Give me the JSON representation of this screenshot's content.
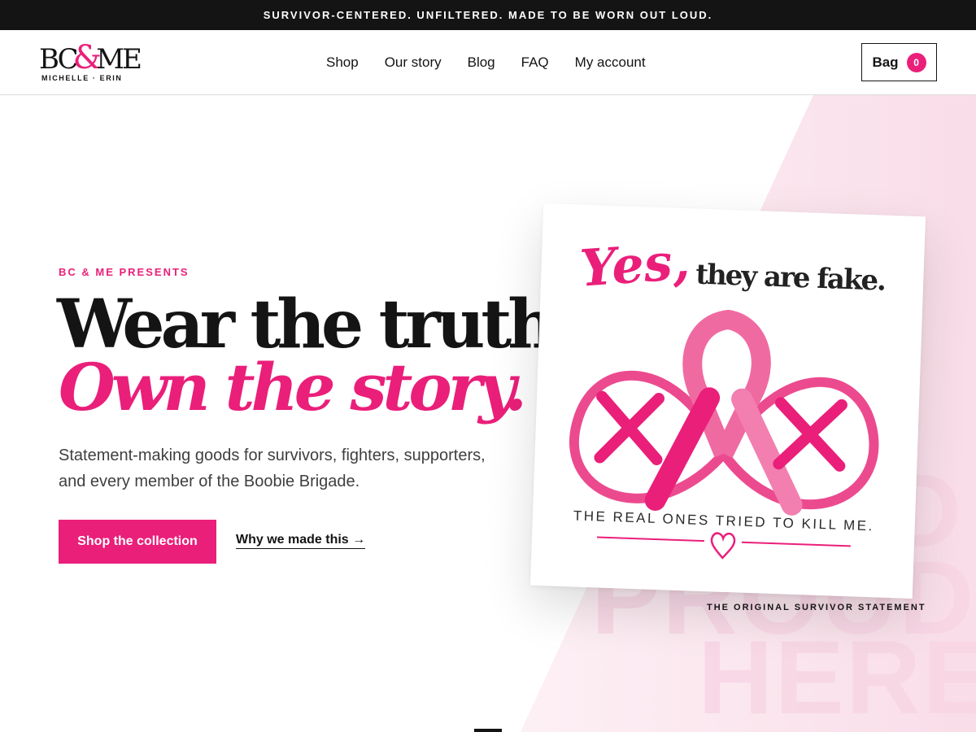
{
  "announcement": "SURVIVOR-CENTERED. UNFILTERED. MADE TO BE WORN OUT LOUD.",
  "logo": {
    "main_left": "BC",
    "amp": "&",
    "main_right": "ME",
    "sub": "MICHELLE · ERIN"
  },
  "nav": [
    "Shop",
    "Our story",
    "Blog",
    "FAQ",
    "My account"
  ],
  "bag": {
    "label": "Bag",
    "count": "0"
  },
  "hero": {
    "eyebrow": "BC & ME PRESENTS",
    "headline": "Wear the truth.",
    "headline_accent": "Own the story.",
    "lead": "Statement-making goods for survivors, fighters, supporters, and every member of the Boobie Brigade.",
    "primary_cta": "Shop the collection",
    "secondary_cta": "Why we made this →"
  },
  "ghost_text": [
    "D",
    "PROUD",
    "HERE"
  ],
  "product_card": {
    "script_word": "Yes,",
    "tagline": "they are fake.",
    "subline": "THE REAL ONES TRIED TO KILL ME.",
    "caption": "THE ORIGINAL SURVIVOR STATEMENT"
  },
  "colors": {
    "accent": "#ea1f7a",
    "ink": "#141414",
    "announce_bg": "#141414",
    "ghost": "#f8d5e4"
  },
  "icons": [
    "ribbon-icon",
    "heart-icon"
  ]
}
